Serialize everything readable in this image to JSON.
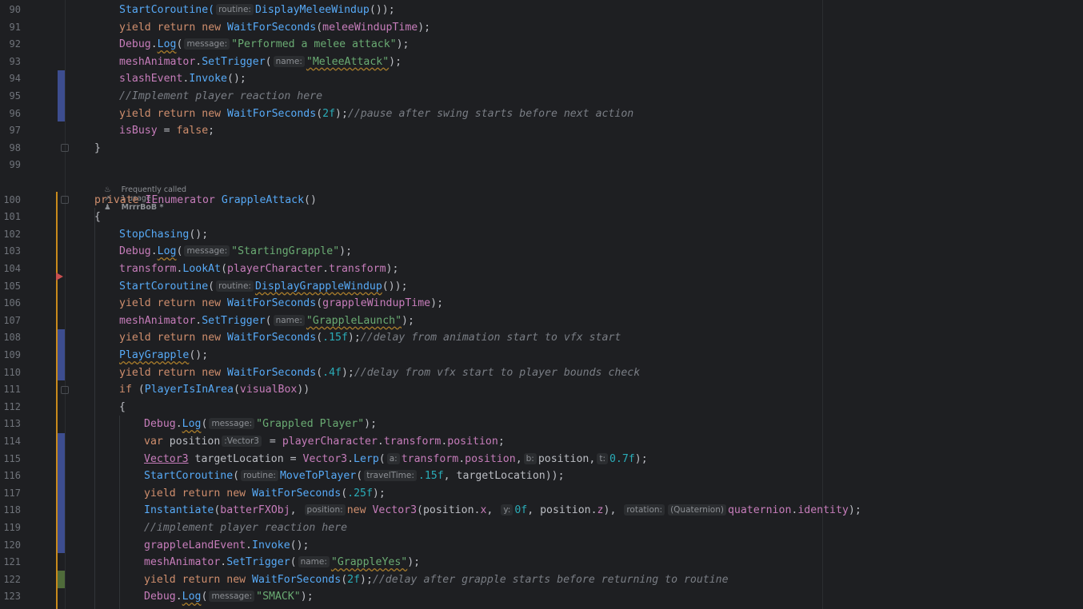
{
  "code_hints": {
    "frequently_called": "Frequently called",
    "usages": "1 usage",
    "author": "MrrrBoB *"
  },
  "line_numbers": [
    "90",
    "91",
    "92",
    "93",
    "94",
    "95",
    "96",
    "97",
    "98",
    "99",
    "100",
    "101",
    "102",
    "103",
    "104",
    "105",
    "106",
    "107",
    "108",
    "109",
    "110",
    "111",
    "112",
    "113",
    "114",
    "115",
    "116",
    "117",
    "118",
    "119",
    "120",
    "121",
    "122",
    "123"
  ],
  "colors": {
    "background": "#1e1f22",
    "modified_marker": "#3d4d8f",
    "added_marker": "#4f6b3a",
    "breakpoint": "#c94f4f",
    "gutter_line": "#c98a1c"
  },
  "lines": {
    "l90": [
      "StartCoroutine(",
      "routine:",
      "DisplayMeleeWindup",
      "());"
    ],
    "l91": [
      "yield",
      "return",
      "new",
      "WaitForSeconds",
      "(",
      "meleeWindupTime",
      ");"
    ],
    "l92": [
      "Debug",
      ".",
      "Log",
      "(",
      "message:",
      "\"Performed a melee attack\"",
      ");"
    ],
    "l93": [
      "meshAnimator",
      ".",
      "SetTrigger",
      "(",
      "name:",
      "\"MeleeAttack\"",
      ");"
    ],
    "l94": [
      "slashEvent",
      ".",
      "Invoke",
      "();"
    ],
    "l95": [
      "//Implement player reaction here"
    ],
    "l96": [
      "yield",
      "return",
      "new",
      "WaitForSeconds",
      "(",
      "2f",
      ");",
      "//pause after swing starts before next action"
    ],
    "l97": [
      "isBusy",
      " = ",
      "false",
      ";"
    ],
    "l98": [
      "}"
    ],
    "l100": [
      "private",
      "IEnumerator",
      "GrappleAttack",
      "()"
    ],
    "l101": [
      "{"
    ],
    "l102": [
      "StopChasing",
      "();"
    ],
    "l103": [
      "Debug",
      ".",
      "Log",
      "(",
      "message:",
      "\"StartingGrapple\"",
      ");"
    ],
    "l104": [
      "transform",
      ".",
      "LookAt",
      "(",
      "playerCharacter",
      ".",
      "transform",
      ");"
    ],
    "l105": [
      "StartCoroutine",
      "(",
      "routine:",
      "DisplayGrappleWindup",
      "());"
    ],
    "l106": [
      "yield",
      "return",
      "new",
      "WaitForSeconds",
      "(",
      "grappleWindupTime",
      ");"
    ],
    "l107": [
      "meshAnimator",
      ".",
      "SetTrigger",
      "(",
      "name:",
      "\"GrappleLaunch\"",
      ");"
    ],
    "l108": [
      "yield",
      "return",
      "new",
      "WaitForSeconds",
      "(",
      ".15f",
      ");",
      "//delay from animation start to vfx start"
    ],
    "l109": [
      "PlayGrapple",
      "();"
    ],
    "l110": [
      "yield",
      "return",
      "new",
      "WaitForSeconds",
      "(",
      ".4f",
      ");",
      "//delay from vfx start to player bounds check"
    ],
    "l111": [
      "if",
      " (",
      "PlayerIsInArea",
      "(",
      "visualBox",
      "))"
    ],
    "l112": [
      "{"
    ],
    "l113": [
      "Debug",
      ".",
      "Log",
      "(",
      "message:",
      "\"Grappled Player\"",
      ");"
    ],
    "l114": [
      "var",
      " position",
      ":Vector3",
      " = ",
      "playerCharacter",
      ".",
      "transform",
      ".",
      "position",
      ";"
    ],
    "l115": [
      "Vector3",
      " targetLocation = ",
      "Vector3",
      ".",
      "Lerp",
      "(",
      "a:",
      "transform",
      ".",
      "position",
      ",",
      "b:",
      "position",
      ",",
      "t:",
      "0.7f",
      ");"
    ],
    "l116": [
      "StartCoroutine",
      "(",
      "routine:",
      "MoveToPlayer",
      "(",
      "travelTime:",
      ".15f",
      ", targetLocation));"
    ],
    "l117": [
      "yield",
      "return",
      "new",
      "WaitForSeconds",
      "(",
      ".25f",
      ");"
    ],
    "l118": [
      "Instantiate",
      "(",
      "batterFXObj",
      ",",
      "position:",
      "new",
      "Vector3",
      "(position.",
      "x",
      ",",
      "y:",
      "0f",
      ", position.",
      "z",
      "),",
      "rotation:",
      "(Quaternion)",
      "quaternion",
      ".",
      "identity",
      ");"
    ],
    "l119": [
      "//implement player reaction here"
    ],
    "l120": [
      "grappleLandEvent",
      ".",
      "Invoke",
      "();"
    ],
    "l121": [
      "meshAnimator",
      ".",
      "SetTrigger",
      "(",
      "name:",
      "\"GrappleYes\"",
      ");"
    ],
    "l122": [
      "yield",
      "return",
      "new",
      "WaitForSeconds",
      "(",
      "2f",
      ");",
      "//delay after grapple starts before returning to routine"
    ],
    "l123": [
      "Debug",
      ".",
      "Log",
      "(",
      "message:",
      "\"SMACK\"",
      ");"
    ]
  }
}
